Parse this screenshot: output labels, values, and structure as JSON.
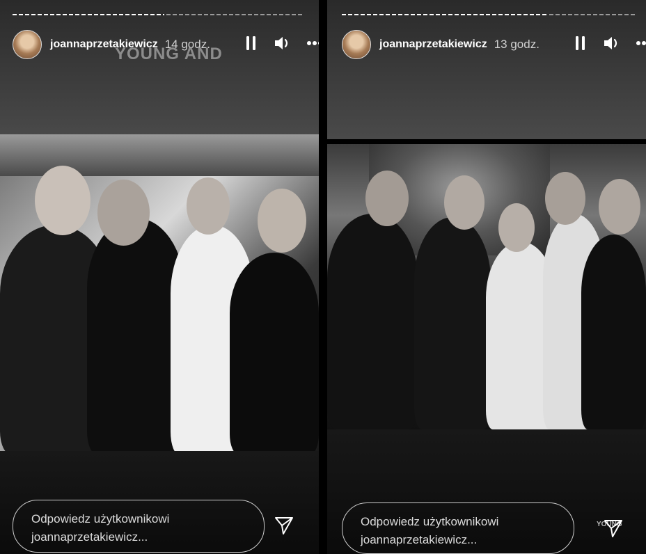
{
  "stories": [
    {
      "username": "joannaprzetakiewicz",
      "time": "14 godz.",
      "overlay_text": "YOUNG AND",
      "reply_placeholder_line1": "Odpowiedz użytkownikowi",
      "reply_placeholder_line2": "joannaprzetakiewicz...",
      "icons": [
        "pause-icon",
        "volume-icon",
        "more-icon",
        "send-icon"
      ]
    },
    {
      "username": "joannaprzetakiewicz",
      "time": "13 godz.",
      "reply_placeholder_line1": "Odpowiedz użytkownikowi",
      "reply_placeholder_line2": "joannaprzetakiewicz...",
      "watermark": "YOUNG",
      "icons": [
        "pause-icon",
        "volume-icon",
        "more-icon",
        "send-icon"
      ]
    }
  ],
  "colors": {
    "background": "#000000",
    "text": "#ffffff",
    "muted": "#cfcfcf"
  }
}
